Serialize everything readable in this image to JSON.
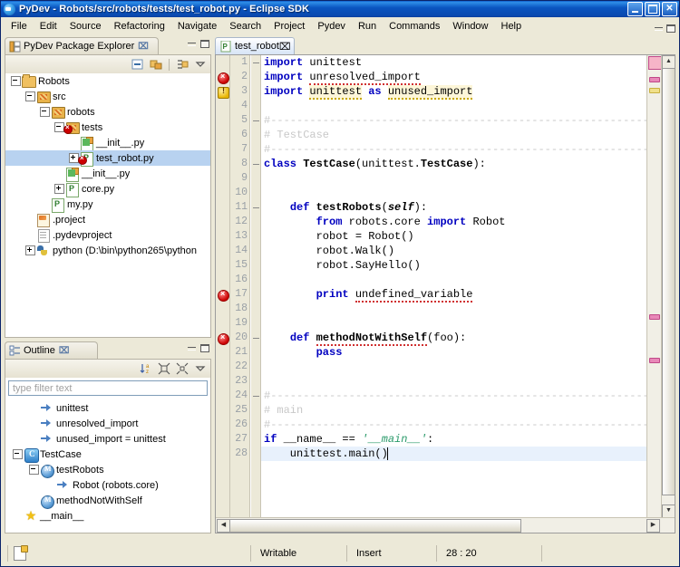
{
  "window": {
    "title": "PyDev - Robots/src/robots/tests/test_robot.py - Eclipse SDK",
    "app_icon": "eclipse-icon",
    "minimize": "_",
    "maximize": "□",
    "close": "✕"
  },
  "menubar": {
    "items": [
      {
        "label": "File"
      },
      {
        "label": "Edit"
      },
      {
        "label": "Source"
      },
      {
        "label": "Refactoring"
      },
      {
        "label": "Navigate"
      },
      {
        "label": "Search"
      },
      {
        "label": "Project"
      },
      {
        "label": "Pydev"
      },
      {
        "label": "Run"
      },
      {
        "label": "Commands"
      },
      {
        "label": "Window"
      },
      {
        "label": "Help"
      }
    ]
  },
  "package_explorer": {
    "title": "PyDev Package Explorer",
    "close_glyph": "⌧",
    "toolbar": [
      {
        "name": "collapse-all-icon"
      },
      {
        "name": "link-with-editor-icon"
      },
      {
        "name": "focus-on-active-task-icon"
      },
      {
        "name": "view-menu-icon"
      }
    ],
    "tree": [
      {
        "label": "Robots",
        "icon": "project-folder-icon",
        "depth": 0,
        "expander": "minus"
      },
      {
        "label": "src",
        "icon": "source-folder-icon",
        "depth": 1,
        "expander": "minus"
      },
      {
        "label": "robots",
        "icon": "package-icon",
        "depth": 2,
        "expander": "minus"
      },
      {
        "label": "tests",
        "icon": "package-error-icon",
        "depth": 3,
        "expander": "minus"
      },
      {
        "label": "__init__.py",
        "icon": "python-init-icon",
        "depth": 4,
        "expander": "none"
      },
      {
        "label": "test_robot.py",
        "icon": "python-error-icon",
        "depth": 4,
        "expander": "plus",
        "selected": true
      },
      {
        "label": "__init__.py",
        "icon": "python-init-icon",
        "depth": 3,
        "expander": "none"
      },
      {
        "label": "core.py",
        "icon": "python-icon",
        "depth": 3,
        "expander": "plus"
      },
      {
        "label": "my.py",
        "icon": "python-icon",
        "depth": 2,
        "expander": "none"
      },
      {
        "label": ".project",
        "icon": "project-file-icon",
        "depth": 1,
        "expander": "none"
      },
      {
        "label": ".pydevproject",
        "icon": "document-icon",
        "depth": 1,
        "expander": "none"
      },
      {
        "label": "python  (D:\\bin\\python265\\python",
        "icon": "python-interpreter-icon",
        "depth": 1,
        "expander": "plus"
      }
    ]
  },
  "outline": {
    "title": "Outline",
    "close_glyph": "⌧",
    "toolbar": [
      {
        "name": "sort-az-icon"
      },
      {
        "name": "collapse-all-icon"
      },
      {
        "name": "expand-all-icon"
      },
      {
        "name": "view-menu-icon"
      }
    ],
    "filter_placeholder": "type filter text",
    "tree": [
      {
        "label": "unittest",
        "icon": "import-icon",
        "depth": 1,
        "expander": "none"
      },
      {
        "label": "unresolved_import",
        "icon": "import-icon",
        "depth": 1,
        "expander": "none"
      },
      {
        "label": "unused_import = unittest",
        "icon": "import-icon",
        "depth": 1,
        "expander": "none"
      },
      {
        "label": "TestCase",
        "icon": "class-icon",
        "depth": 0,
        "expander": "minus"
      },
      {
        "label": "testRobots",
        "icon": "method-icon",
        "depth": 1,
        "expander": "minus"
      },
      {
        "label": "Robot (robots.core)",
        "icon": "import-icon",
        "depth": 2,
        "expander": "none"
      },
      {
        "label": "methodNotWithSelf",
        "icon": "method-icon",
        "depth": 1,
        "expander": "none"
      },
      {
        "label": "__main__",
        "icon": "star-icon",
        "depth": 0,
        "expander": "none"
      }
    ]
  },
  "editor": {
    "tab_label": "test_robot",
    "tab_icon": "python-file-icon",
    "close_glyph": "⌧",
    "cursor_line": 28,
    "lines": [
      {
        "n": 1,
        "marker": "none",
        "fold": true,
        "text": "import unittest"
      },
      {
        "n": 2,
        "marker": "error",
        "fold": false,
        "text": "import unresolved_import"
      },
      {
        "n": 3,
        "marker": "warning",
        "fold": false,
        "text": "import unittest as unused_import"
      },
      {
        "n": 4,
        "marker": "none",
        "fold": false,
        "text": ""
      },
      {
        "n": 5,
        "marker": "none",
        "fold": true,
        "text": "#----------------------------------------------------------"
      },
      {
        "n": 6,
        "marker": "none",
        "fold": false,
        "text": "# TestCase"
      },
      {
        "n": 7,
        "marker": "none",
        "fold": false,
        "text": "#----------------------------------------------------------"
      },
      {
        "n": 8,
        "marker": "none",
        "fold": true,
        "text": "class TestCase(unittest.TestCase):"
      },
      {
        "n": 9,
        "marker": "none",
        "fold": false,
        "text": ""
      },
      {
        "n": 10,
        "marker": "none",
        "fold": false,
        "text": ""
      },
      {
        "n": 11,
        "marker": "none",
        "fold": true,
        "text": "    def testRobots(self):"
      },
      {
        "n": 12,
        "marker": "none",
        "fold": false,
        "text": "        from robots.core import Robot"
      },
      {
        "n": 13,
        "marker": "none",
        "fold": false,
        "text": "        robot = Robot()"
      },
      {
        "n": 14,
        "marker": "none",
        "fold": false,
        "text": "        robot.Walk()"
      },
      {
        "n": 15,
        "marker": "none",
        "fold": false,
        "text": "        robot.SayHello()"
      },
      {
        "n": 16,
        "marker": "none",
        "fold": false,
        "text": ""
      },
      {
        "n": 17,
        "marker": "error",
        "fold": false,
        "text": "        print undefined_variable"
      },
      {
        "n": 18,
        "marker": "none",
        "fold": false,
        "text": ""
      },
      {
        "n": 19,
        "marker": "none",
        "fold": false,
        "text": ""
      },
      {
        "n": 20,
        "marker": "error",
        "fold": true,
        "text": "    def methodNotWithSelf(foo):"
      },
      {
        "n": 21,
        "marker": "none",
        "fold": false,
        "text": "        pass"
      },
      {
        "n": 22,
        "marker": "none",
        "fold": false,
        "text": ""
      },
      {
        "n": 23,
        "marker": "none",
        "fold": false,
        "text": ""
      },
      {
        "n": 24,
        "marker": "none",
        "fold": true,
        "text": "#----------------------------------------------------------"
      },
      {
        "n": 25,
        "marker": "none",
        "fold": false,
        "text": "# main"
      },
      {
        "n": 26,
        "marker": "none",
        "fold": false,
        "text": "#----------------------------------------------------------"
      },
      {
        "n": 27,
        "marker": "none",
        "fold": false,
        "text": "if __name__ == '__main__':"
      },
      {
        "n": 28,
        "marker": "none",
        "fold": false,
        "text": "    unittest.main()"
      }
    ]
  },
  "statusbar": {
    "icon": "writable-doc-icon",
    "writable": "Writable",
    "insert_mode": "Insert",
    "position": "28 : 20"
  },
  "colors": {
    "title_start": "#0a5ac8",
    "title_end": "#093f9c",
    "selection": "#b8d2f0",
    "chrome": "#ece9d8",
    "keyword": "#0000c0",
    "string": "#2a9a6a",
    "comment": "#c8c8c8",
    "error": "#cc0000",
    "warning": "#e8b400",
    "cursor_line": "#e8f1fc"
  }
}
